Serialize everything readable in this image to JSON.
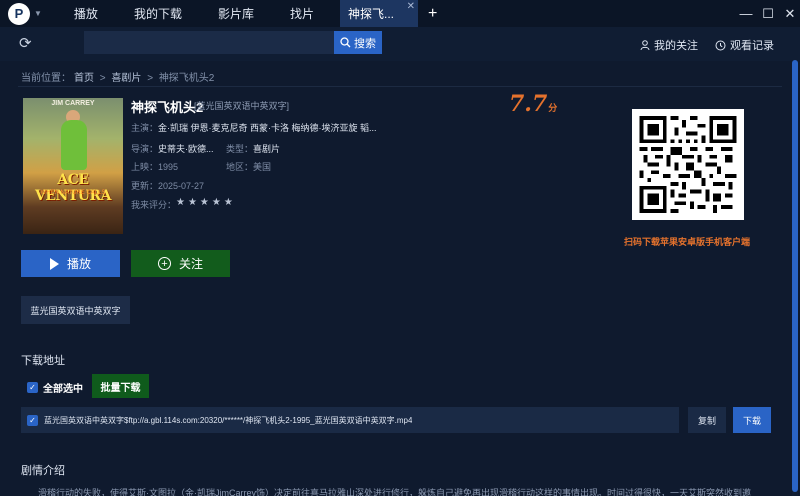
{
  "app": {
    "logo": "P"
  },
  "tabs": [
    {
      "label": "播放"
    },
    {
      "label": "我的下载"
    },
    {
      "label": "影片库"
    },
    {
      "label": "找片"
    },
    {
      "label": "神探飞..."
    }
  ],
  "window": {
    "minimize": "—",
    "maximize": "☐",
    "close": "✕"
  },
  "search": {
    "value": "",
    "placeholder": "",
    "button_label": "搜索"
  },
  "toplinks": {
    "follow": "我的关注",
    "history": "观看记录"
  },
  "breadcrumb": {
    "prefix": "当前位置：",
    "home": "首页",
    "sep": ">",
    "category": "喜剧片",
    "current": "神探飞机头2"
  },
  "movie": {
    "title": "神探飞机头2",
    "subtag": "[蓝光国英双语中英双字]",
    "score": "7.7",
    "score_unit": "分",
    "cast_label": "主演：",
    "cast": "金·凯瑞  伊恩·麦克尼奇  西蒙·卡洛  梅纳德·埃济亚旋  韬...",
    "director_label": "导演：",
    "director": "史蒂夫·欧德...",
    "genre_label": "类型：",
    "genre": "喜剧片",
    "release_label": "上映：",
    "release": "1995",
    "region_label": "地区：",
    "region": "美国",
    "updated_label": "更新：",
    "updated": "2025-07-27",
    "rating_label": "我来评分：",
    "rating_stars": "★★★★★",
    "poster_line1": "JIM CARREY",
    "poster_line2": "ACE VENTURA",
    "poster_line3": "WHEN NATURE CALLS"
  },
  "qr": {
    "caption": "扫码下载苹果安卓版手机客户端"
  },
  "actions": {
    "play": "播放",
    "follow": "关注"
  },
  "source_tab": "蓝光国英双语中英双字",
  "download": {
    "section_title": "下载地址",
    "select_all": "全部选中",
    "batch": "批量下载",
    "item": "蓝光国英双语中英双字$ftp://a.gbl.114s.com:20320/******/神探飞机头2-1995_蓝光国英双语中英双字.mp4",
    "copy": "复制",
    "download": "下载"
  },
  "plot": {
    "section_title": "剧情介绍",
    "text": "滑稽行动的失败，使得艾斯·文图拉（金·凯瑞JimCarrey饰）决定前往喜马拉雅山深处进行修行，躲炼自己避免再出现滑稽行动这样的事情出现。时间过得很快，一天艾斯突然收到邀"
  },
  "colors": {
    "accent": "#2a64c6",
    "green": "#125c1c",
    "orange": "#e5722d",
    "bg": "#0f1a2e"
  }
}
